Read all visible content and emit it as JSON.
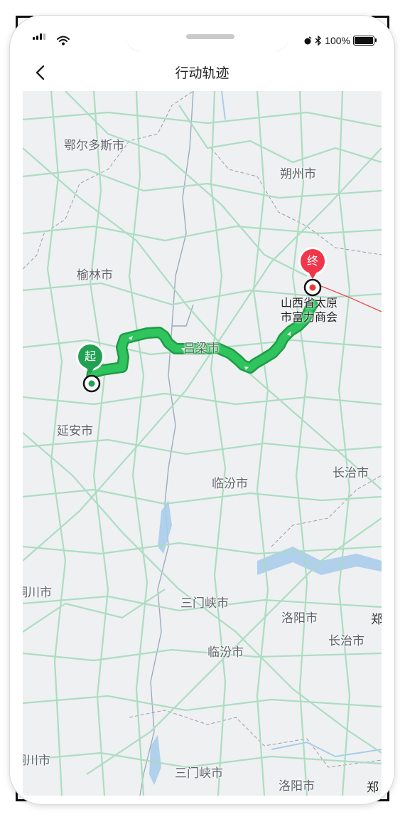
{
  "status_bar": {
    "battery": "100%"
  },
  "nav": {
    "back_icon": "chevron-left-icon",
    "title": "行动轨迹"
  },
  "map": {
    "start_marker": "起",
    "end_marker": "终",
    "end_location": [
      "山西省太原",
      "市富力商会"
    ],
    "cities": {
      "erdos": "鄂尔多斯市",
      "shuozhou": "朔州市",
      "yulin": "榆林市",
      "lvliang": "吕梁市",
      "yanan": "延安市",
      "linfen1": "临汾市",
      "changzhi1": "长治市",
      "tongchuan1": "铜川市",
      "sanmenxia1": "三门峡市",
      "luoyang1": "洛阳市",
      "zheng1": "郑",
      "changzhi2": "长治市",
      "linfen2": "临汾市",
      "tongchuan2": "铜川市",
      "sanmenxia2": "三门峡市",
      "luoyang2": "洛阳市",
      "zheng2": "郑"
    },
    "colors": {
      "route": "#21b14e",
      "start_pin": "#21a152",
      "end_pin": "#f0364a",
      "roads": "#a9dcc0"
    }
  }
}
